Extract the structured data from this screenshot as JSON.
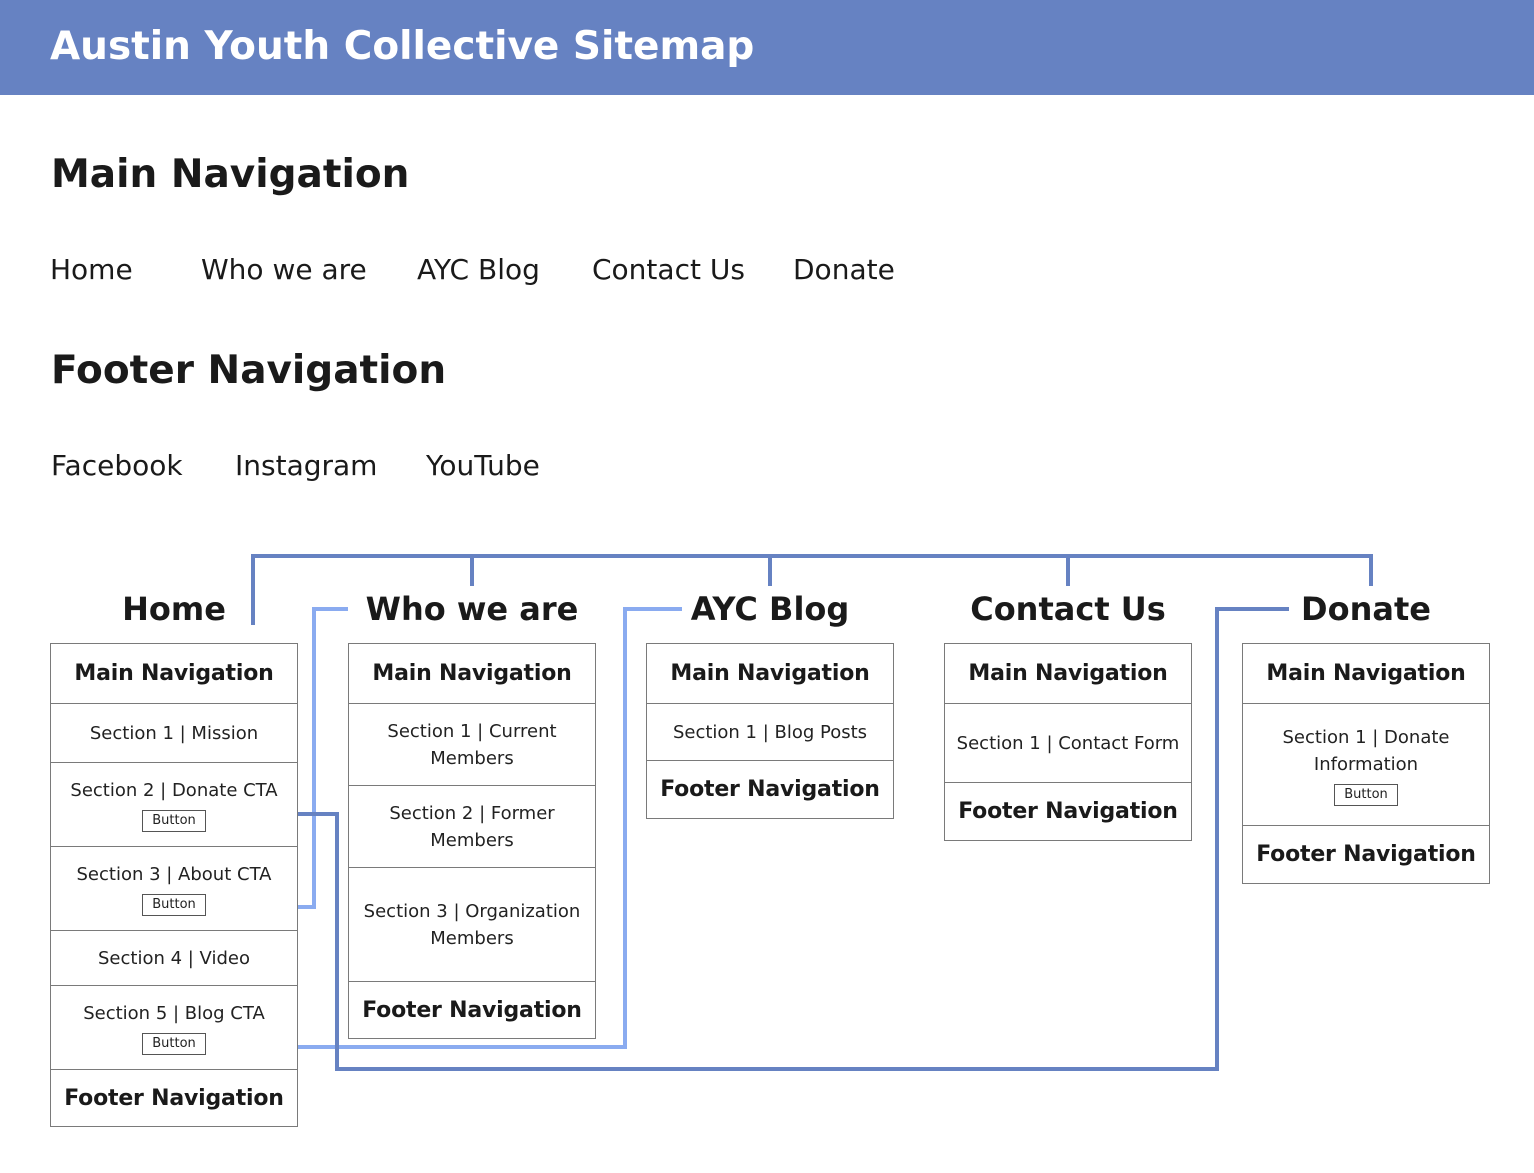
{
  "header": {
    "title": "Austin Youth Collective Sitemap"
  },
  "main_navigation": {
    "heading": "Main Navigation",
    "links": [
      "Home",
      "Who we are",
      "AYC Blog",
      "Contact Us",
      "Donate"
    ]
  },
  "footer_navigation": {
    "heading": "Footer Navigation",
    "links": [
      "Facebook",
      "Instagram",
      "YouTube"
    ]
  },
  "colors": {
    "banner": "#6682c2",
    "hierarchy_line": "#6682c2",
    "link_light": "#8aabf0",
    "link_dark": "#6682c2",
    "box_border": "#7a7a7a"
  },
  "pages": [
    {
      "title": "Home",
      "cells": [
        {
          "kind": "nav",
          "text": "Main Navigation"
        },
        {
          "kind": "section",
          "text": "Section 1 | Mission"
        },
        {
          "kind": "section",
          "text": "Section 2 | Donate CTA",
          "button": "Button"
        },
        {
          "kind": "section",
          "text": "Section 3 | About CTA",
          "button": "Button"
        },
        {
          "kind": "section",
          "text": "Section 4 | Video"
        },
        {
          "kind": "section",
          "text": "Section 5 | Blog CTA",
          "button": "Button"
        },
        {
          "kind": "nav",
          "text": "Footer Navigation"
        }
      ]
    },
    {
      "title": "Who we are",
      "cells": [
        {
          "kind": "nav",
          "text": "Main Navigation"
        },
        {
          "kind": "section",
          "text": "Section 1 | Current Members"
        },
        {
          "kind": "section",
          "text": "Section 2 | Former Members"
        },
        {
          "kind": "section",
          "text": "Section 3 | Organization Members"
        },
        {
          "kind": "nav",
          "text": "Footer Navigation"
        }
      ]
    },
    {
      "title": "AYC Blog",
      "cells": [
        {
          "kind": "nav",
          "text": "Main Navigation"
        },
        {
          "kind": "section",
          "text": "Section 1 | Blog Posts"
        },
        {
          "kind": "nav",
          "text": "Footer Navigation"
        }
      ]
    },
    {
      "title": "Contact Us",
      "cells": [
        {
          "kind": "nav",
          "text": "Main Navigation"
        },
        {
          "kind": "section",
          "text": "Section 1 | Contact Form"
        },
        {
          "kind": "nav",
          "text": "Footer Navigation"
        }
      ]
    },
    {
      "title": "Donate",
      "cells": [
        {
          "kind": "nav",
          "text": "Main Navigation"
        },
        {
          "kind": "section",
          "text": "Section 1 | Donate Information",
          "button": "Button"
        },
        {
          "kind": "nav",
          "text": "Footer Navigation"
        }
      ]
    }
  ]
}
